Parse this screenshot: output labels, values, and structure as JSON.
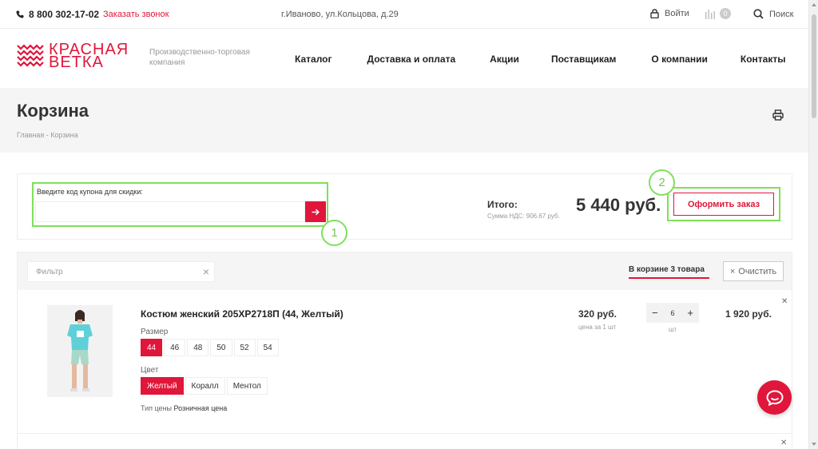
{
  "topbar": {
    "phone": "8 800 302-17-02",
    "callback": "Заказать звонок",
    "address": "г.Иваново, ул.Кольцова, д.29",
    "login": "Войти",
    "compare_count": "0",
    "search": "Поиск"
  },
  "header": {
    "logo_line1": "КРАСНАЯ",
    "logo_line2": "ВЕТКА",
    "tagline": "Производственно-торговая компания",
    "nav": [
      "Каталог",
      "Доставка и оплата",
      "Акции",
      "Поставщикам",
      "О компании",
      "Контакты"
    ]
  },
  "page": {
    "title": "Корзина",
    "breadcrumb_home": "Главная",
    "breadcrumb_sep": "-",
    "breadcrumb_current": "Корзина"
  },
  "summary": {
    "coupon_label": "Введите код купона для скидки:",
    "coupon_value": "",
    "total_label": "Итого:",
    "vat": "Сумма НДС: 906.67 руб.",
    "total_value": "5 440 руб.",
    "checkout": "Оформить заказ"
  },
  "annotations": [
    "1",
    "2"
  ],
  "cart": {
    "filter_placeholder": "Фильтр",
    "count_label": "В корзине 3 товара",
    "clear": "Очистить",
    "items": [
      {
        "name": "Костюм женский 205ХР2718П (44, Желтый)",
        "size_label": "Размер",
        "sizes": [
          "44",
          "46",
          "48",
          "50",
          "52",
          "54"
        ],
        "selected_size": "44",
        "color_label": "Цвет",
        "colors": [
          "Желтый",
          "Коралл",
          "Ментол"
        ],
        "selected_color": "Желтый",
        "price_type_label": "Тип цены",
        "price_type": "Розничная цена",
        "price": "320 руб.",
        "price_unit": "цена за 1 шт",
        "qty": "6",
        "qty_unit": "шт",
        "sum": "1 920 руб."
      }
    ]
  },
  "colors": {
    "accent": "#e0163a",
    "annotation": "#7fe05a",
    "band": "#f5f5f5"
  }
}
